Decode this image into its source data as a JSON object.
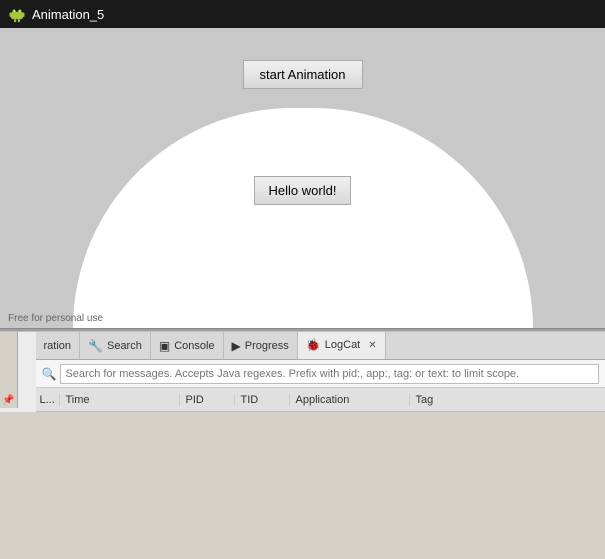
{
  "titlebar": {
    "title": "Animation_5",
    "icon": "android-icon"
  },
  "emulator": {
    "start_button_label": "start Animation",
    "hello_label": "Hello world!",
    "watermark": "Free for personal use"
  },
  "tabs": [
    {
      "id": "declaration",
      "label": "ration",
      "icon": "",
      "active": false,
      "closeable": false
    },
    {
      "id": "search",
      "label": "Search",
      "icon": "🔧",
      "active": false,
      "closeable": false
    },
    {
      "id": "console",
      "label": "Console",
      "icon": "▣",
      "active": false,
      "closeable": false
    },
    {
      "id": "progress",
      "label": "Progress",
      "icon": "▶",
      "active": false,
      "closeable": false
    },
    {
      "id": "logcat",
      "label": "LogCat",
      "icon": "🐞",
      "active": true,
      "closeable": true
    }
  ],
  "search": {
    "placeholder": "Search for messages. Accepts Java regexes. Prefix with pid:, app:, tag: or text: to limit scope.",
    "value": ""
  },
  "table": {
    "columns": [
      "L...",
      "Time",
      "PID",
      "TID",
      "Application",
      "Tag"
    ],
    "rows": []
  },
  "toolbar": {
    "icon": "📌"
  }
}
